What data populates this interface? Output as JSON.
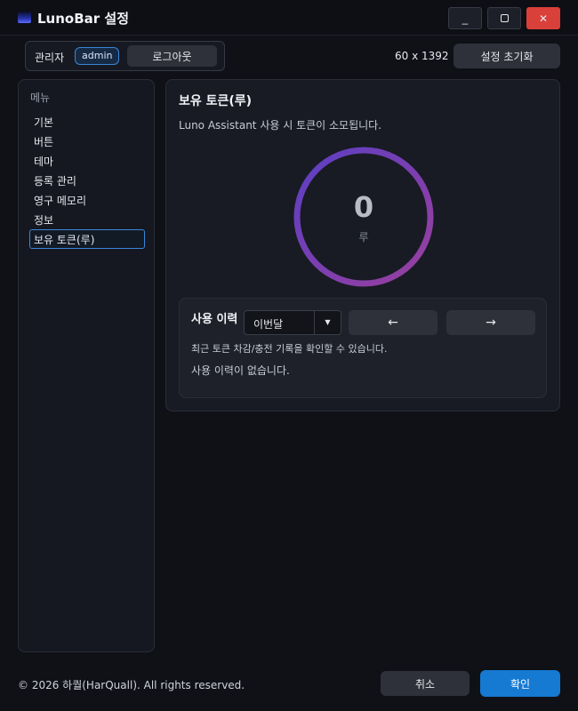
{
  "window": {
    "title": "LunoBar 설정",
    "minimize_label": "_",
    "close_label": "✕",
    "logo_icon": "app-logo-icon"
  },
  "header": {
    "user_label": "관리자",
    "user_badge": "admin",
    "logout_label": "로그아웃",
    "resolution": "60 x 1392",
    "reset_label": "설정 초기화"
  },
  "sidebar": {
    "title": "메뉴",
    "items": [
      {
        "label": "기본"
      },
      {
        "label": "버튼"
      },
      {
        "label": "테마"
      },
      {
        "label": "등록 관리"
      },
      {
        "label": "영구 메모리"
      },
      {
        "label": "정보"
      },
      {
        "label": "보유 토큰(루)",
        "active": true
      }
    ]
  },
  "panel": {
    "title": "보유 토큰(루)",
    "description": "Luno Assistant 사용 시 토큰이 소모됩니다.",
    "token_value": "0",
    "token_unit": "루",
    "ring_colors": [
      "#5b3fc4",
      "#9a3f9e"
    ]
  },
  "history": {
    "title": "사용 이력",
    "selected_period": "이번달",
    "dropdown_arrow": "▼",
    "prev_label": "←",
    "next_label": "→",
    "description": "최근 토큰 차감/충전 기록을 확인할 수 있습니다.",
    "empty_message": "사용 이력이 없습니다."
  },
  "footer": {
    "copyright": "© 2026 하퀄(HarQuall). All rights reserved.",
    "cancel_label": "취소",
    "ok_label": "확인"
  },
  "colors": {
    "accent": "#1679d2",
    "close": "#d9403a",
    "background": "#0f1117"
  }
}
